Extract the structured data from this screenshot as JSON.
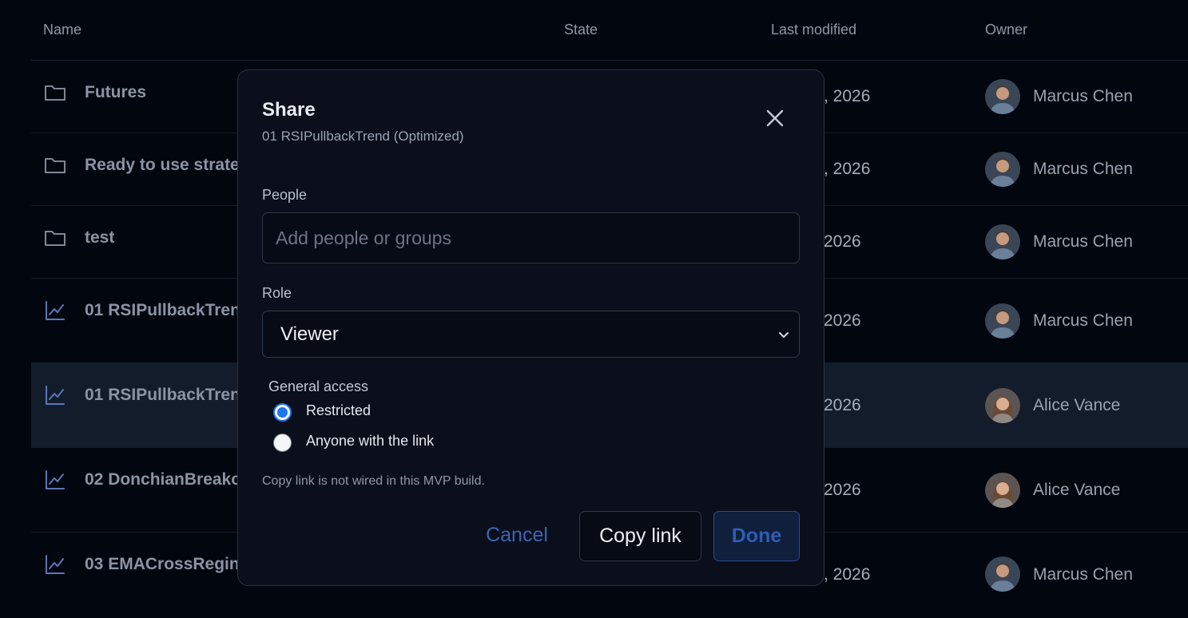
{
  "table": {
    "columns": {
      "name": "Name",
      "state": "State",
      "last_modified": "Last modified",
      "owner": "Owner"
    },
    "rows": [
      {
        "icon": "folder-icon",
        "name": "Futures",
        "date_fragment": ", 2026",
        "owner": "Marcus Chen",
        "avatar": "marcus-avatar"
      },
      {
        "icon": "folder-icon",
        "name": "Ready to use strate",
        "date_fragment": ", 2026",
        "owner": "Marcus Chen",
        "avatar": "marcus-avatar"
      },
      {
        "icon": "folder-icon",
        "name": "test",
        "date_fragment": "2026",
        "owner": "Marcus Chen",
        "avatar": "marcus-avatar"
      },
      {
        "icon": "chart-line-icon",
        "name": "01 RSIPullbackTren",
        "date_fragment": "2026",
        "owner": "Marcus Chen",
        "avatar": "marcus-avatar"
      },
      {
        "icon": "chart-line-icon",
        "name": "01 RSIPullbackTren",
        "date_fragment": "2026",
        "owner": "Alice Vance",
        "avatar": "alice-avatar",
        "selected": true
      },
      {
        "icon": "chart-line-icon",
        "name": "02 DonchianBreako",
        "date_fragment": "2026",
        "owner": "Alice Vance",
        "avatar": "alice-avatar"
      },
      {
        "icon": "chart-line-icon",
        "name": "03 EMACrossRegin",
        "date_fragment": ", 2026",
        "owner": "Marcus Chen",
        "avatar": "marcus-avatar"
      }
    ]
  },
  "dialog": {
    "title": "Share",
    "subtitle": "01 RSIPullbackTrend (Optimized)",
    "close_icon": "close-icon",
    "people_label": "People",
    "people_placeholder": "Add people or groups",
    "people_value": "",
    "role_label": "Role",
    "role_value": "Viewer",
    "general_access_label": "General access",
    "access_options": [
      {
        "label": "Restricted",
        "checked": true
      },
      {
        "label": "Anyone with the link",
        "checked": false
      }
    ],
    "note": "Copy link is not wired in this MVP build.",
    "cancel_label": "Cancel",
    "copy_link_label": "Copy link",
    "done_label": "Done"
  },
  "colors": {
    "background": "#02060f",
    "dialog_bg": "#0a0f1b",
    "accent": "#1d76f0",
    "done_text": "#2e5db3",
    "selected_row": "#121c2b"
  }
}
